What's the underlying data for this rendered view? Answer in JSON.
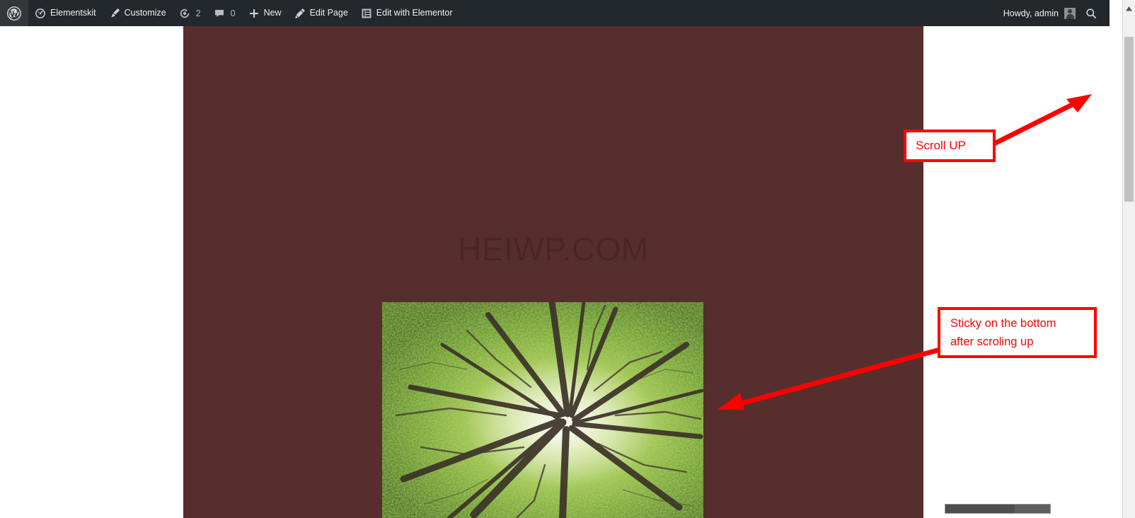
{
  "adminbar": {
    "logo_icon": "wordpress-logo-icon",
    "items": [
      {
        "id": "elementskit",
        "label": "Elementskit",
        "icon": "dashboard-gauge-icon"
      },
      {
        "id": "customize",
        "label": "Customize",
        "icon": "paintbrush-icon"
      },
      {
        "id": "updates",
        "label": "",
        "icon": "updates-icon",
        "count": "2"
      },
      {
        "id": "comments",
        "label": "",
        "icon": "comment-bubble-icon",
        "count": "0"
      },
      {
        "id": "new",
        "label": "New",
        "icon": "plus-icon"
      },
      {
        "id": "edit-page",
        "label": "Edit Page",
        "icon": "pencil-icon"
      },
      {
        "id": "edit-with-elementor",
        "label": "Edit with Elementor",
        "icon": "elementor-icon"
      }
    ],
    "howdy": "Howdy, admin",
    "avatar_icon": "user-avatar-icon",
    "search_icon": "search-icon",
    "background_color": "#23282d",
    "text_color": "#eeeeee"
  },
  "page": {
    "background_color": "#572e2e",
    "watermark": "HEIWP.COM",
    "hero_image_alt": "forest-canopy-photo"
  },
  "annotations": [
    {
      "id": "scroll-up",
      "text": "Scroll UP",
      "color": "#fe0000",
      "arrow_direction": "up-right",
      "points_to": "vertical-scrollbar"
    },
    {
      "id": "sticky-note",
      "lines": [
        "Sticky on the bottom",
        "after scroling up"
      ],
      "color": "#fe0000",
      "arrow_direction": "down-left",
      "points_to": "hero-image"
    }
  ],
  "scrollbars": {
    "vertical": {
      "arrow_up_icon": "caret-up-icon",
      "thumb_color": "#c1c1c1",
      "track_color": "#f1f1f1"
    },
    "horizontal": {
      "thumb_color": "#4e4e4e",
      "track_color": "#5f5f5f"
    }
  }
}
